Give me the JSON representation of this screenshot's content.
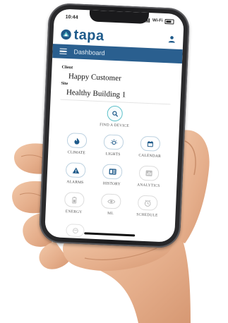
{
  "status_bar": {
    "time": "10:44",
    "signal": "Wi-Fi"
  },
  "brand": {
    "name": "tapa"
  },
  "nav": {
    "title": "Dashboard"
  },
  "client": {
    "label": "Client",
    "value": "Happy Customer"
  },
  "site": {
    "label": "Site",
    "value": "Healthy Building 1"
  },
  "find_device": {
    "label": "FIND A DEVICE"
  },
  "tiles": [
    {
      "label": "CLIMATE",
      "icon": "climate-icon",
      "enabled": true
    },
    {
      "label": "LIGHTS",
      "icon": "lights-icon",
      "enabled": true
    },
    {
      "label": "CALENDAR",
      "icon": "calendar-icon",
      "enabled": true
    },
    {
      "label": "ALARMS",
      "icon": "alarm-icon",
      "enabled": true
    },
    {
      "label": "HISTORY",
      "icon": "history-icon",
      "enabled": true
    },
    {
      "label": "ANALYTICS",
      "icon": "analytics-icon",
      "enabled": false
    },
    {
      "label": "ENERGY",
      "icon": "energy-icon",
      "enabled": false
    },
    {
      "label": "ML",
      "icon": "ml-icon",
      "enabled": false
    },
    {
      "label": "SCHEDULE",
      "icon": "schedule-icon",
      "enabled": false
    }
  ],
  "colors": {
    "brand": "#1e5a8a",
    "navbar": "#2a5f8f",
    "accent": "#5cc0c9",
    "icon": "#1e5a8a"
  }
}
